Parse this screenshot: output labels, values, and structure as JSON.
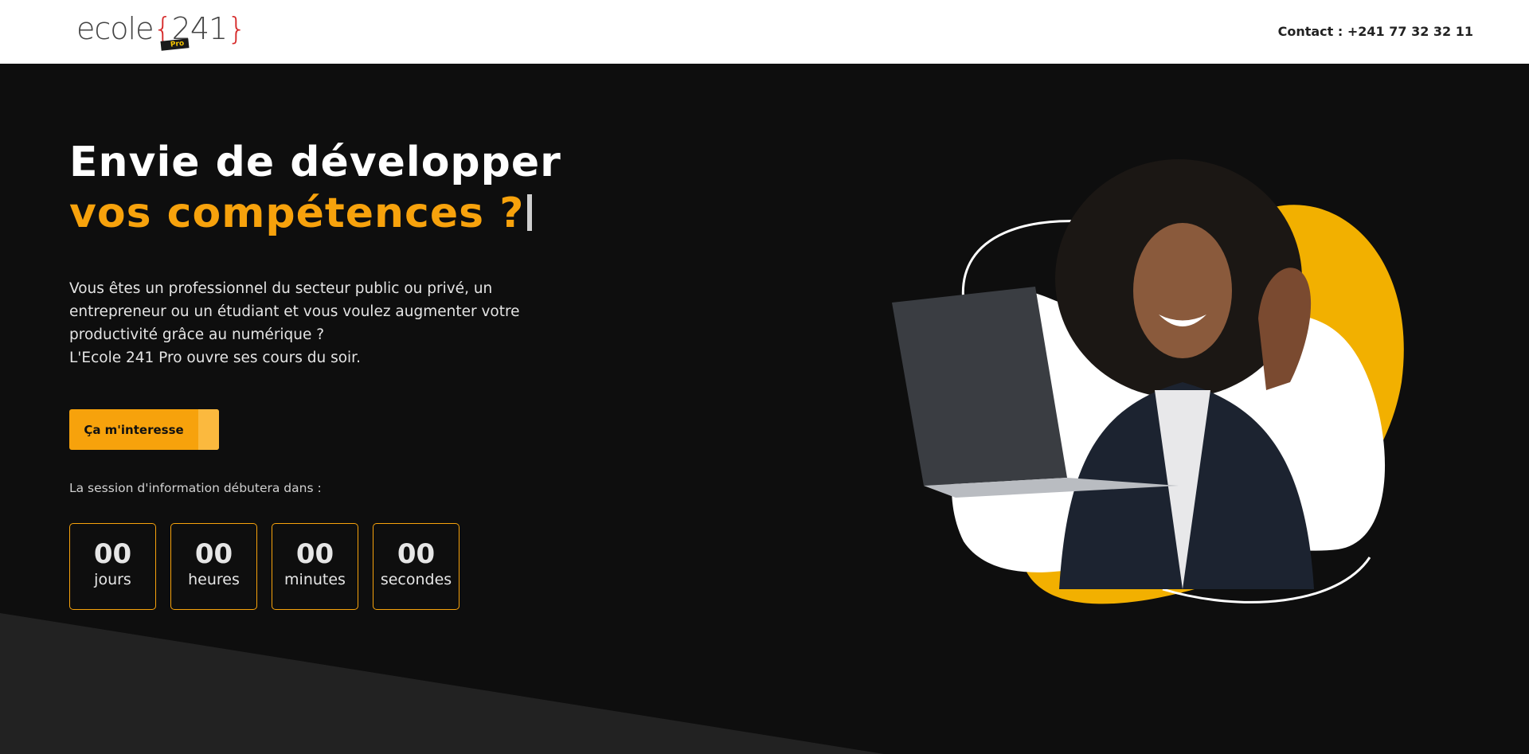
{
  "header": {
    "logo": {
      "word": "ecole",
      "number": "241",
      "badge": "Pro"
    },
    "contact": "Contact : +241 77 32 32 11"
  },
  "hero": {
    "title_line1": "Envie de développer",
    "title_line2": "vos compétences ?",
    "intro_lines": [
      "Vous êtes un professionnel du secteur public ou privé, un",
      "entrepreneur ou un étudiant et vous voulez augmenter votre",
      "productivité grâce au numérique ?",
      "L'Ecole 241 Pro ouvre ses cours du soir."
    ],
    "cta_label": "Ça m'interesse",
    "session_text": "La session d'information débutera dans :",
    "countdown": [
      {
        "value": "00",
        "unit": "jours"
      },
      {
        "value": "00",
        "unit": "heures"
      },
      {
        "value": "00",
        "unit": "minutes"
      },
      {
        "value": "00",
        "unit": "secondes"
      }
    ]
  },
  "colors": {
    "accent": "#f7a20c",
    "background": "#0e0e0e",
    "header_bg": "#ffffff",
    "blob_yellow": "#f2b000"
  }
}
